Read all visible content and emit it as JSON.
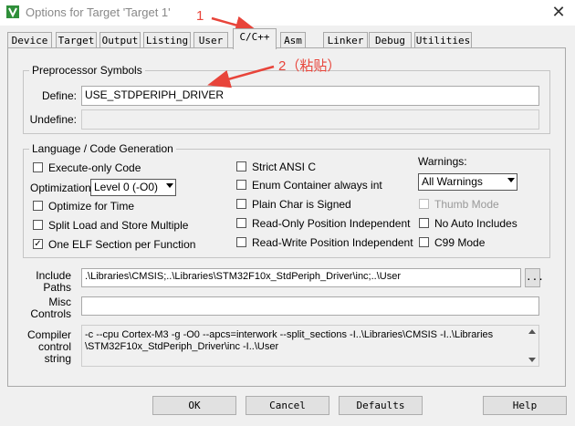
{
  "window": {
    "title": "Options for Target 'Target 1'",
    "close_symbol": "✕"
  },
  "tabs": [
    "Device",
    "Target",
    "Output",
    "Listing",
    "User",
    "C/C++",
    "Asm",
    "Linker",
    "Debug",
    "Utilities"
  ],
  "active_tab": "C/C++",
  "preprocessor": {
    "group_label": "Preprocessor Symbols",
    "define_label": "Define:",
    "define_value": "USE_STDPERIPH_DRIVER",
    "undefine_label": "Undefine:",
    "undefine_value": ""
  },
  "language": {
    "group_label": "Language / Code Generation",
    "execute_only": "Execute-only Code",
    "optimization_label": "Optimization:",
    "optimization_value": "Level 0 (-O0)",
    "optimize_time": "Optimize for Time",
    "split_load": "Split Load and Store Multiple",
    "one_elf": "One ELF Section per Function",
    "strict_ansi": "Strict ANSI C",
    "enum_container": "Enum Container always int",
    "plain_char": "Plain Char is Signed",
    "ro_pos": "Read-Only Position Independent",
    "rw_pos": "Read-Write Position Independent",
    "warnings_label": "Warnings:",
    "warnings_value": "All Warnings",
    "thumb_mode": "Thumb Mode",
    "no_auto_includes": "No Auto Includes",
    "c99_mode": "C99 Mode",
    "checked": "✓"
  },
  "paths": {
    "include_label_1": "Include",
    "include_label_2": "Paths",
    "include_value": ".\\Libraries\\CMSIS;..\\Libraries\\STM32F10x_StdPeriph_Driver\\inc;..\\User",
    "browse_label": "...",
    "misc_label_1": "Misc",
    "misc_label_2": "Controls",
    "misc_value": "",
    "compiler_label_1": "Compiler",
    "compiler_label_2": "control",
    "compiler_label_3": "string",
    "compiler_line_1": "-c --cpu Cortex-M3 -g -O0 --apcs=interwork --split_sections -I..\\Libraries\\CMSIS -I..\\Libraries",
    "compiler_line_2": "\\STM32F10x_StdPeriph_Driver\\inc -I..\\User"
  },
  "buttons": {
    "ok": "OK",
    "cancel": "Cancel",
    "defaults": "Defaults",
    "help": "Help"
  },
  "annotations": {
    "step1": "1",
    "step2": "2（粘贴）"
  },
  "colors": {
    "annotation": "#e8443a",
    "app_icon": "#2f8f3a"
  }
}
